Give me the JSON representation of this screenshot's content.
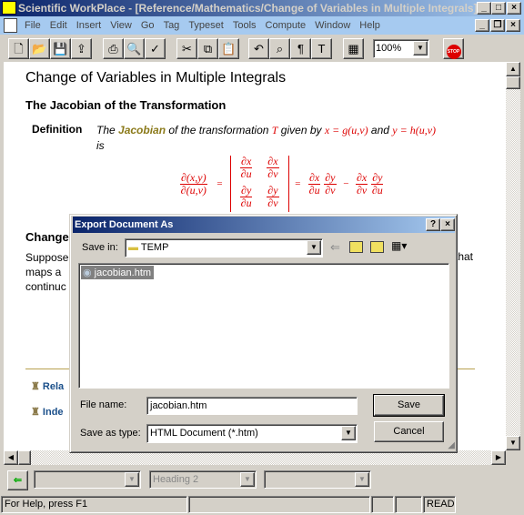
{
  "window": {
    "title": "Scientific WorkPlace - [Reference/Mathematics/Change of Variables in Multiple Integrals]",
    "min": "_",
    "max": "□",
    "close": "×",
    "doc_min": "_",
    "doc_restore": "❐",
    "doc_close": "×"
  },
  "menu": [
    "File",
    "Edit",
    "Insert",
    "View",
    "Go",
    "Tag",
    "Typeset",
    "Tools",
    "Compute",
    "Window",
    "Help"
  ],
  "toolbar": {
    "zoom": "100%",
    "stop": "STOP"
  },
  "document": {
    "heading": "Change of Variables in Multiple Integrals",
    "subheading": "The Jacobian of the Transformation",
    "definition_label": "Definition",
    "def_text_1": "The ",
    "def_jacobian": "Jacobian",
    "def_text_2": " of the transformation ",
    "def_T": "T",
    "def_text_3": " given by ",
    "def_x": "x = g(u,v)",
    "def_text_4": " and ",
    "def_y": "y = h(u,v)",
    "def_text_5": "is",
    "math": {
      "lhs_num": "∂(x,y)",
      "lhs_den": "∂(u,v)",
      "m11n": "∂x",
      "m11d": "∂u",
      "m12n": "∂x",
      "m12d": "∂v",
      "m21n": "∂y",
      "m21d": "∂u",
      "m22n": "∂y",
      "m22d": "∂v",
      "eq": "=",
      "minus": "−",
      "r1n": "∂x",
      "r1d": "∂u",
      "r2n": "∂y",
      "r2d": "∂v",
      "r3n": "∂x",
      "r3d": "∂v",
      "r4n": "∂y",
      "r4d": "∂u"
    },
    "section2": "Change",
    "p1": "Suppose",
    "p1_end": "that",
    "p2": "maps a",
    "p3": "continuc",
    "link1": "Rela",
    "link2": "Inde"
  },
  "dialog": {
    "title": "Export Document As",
    "help": "?",
    "close": "×",
    "save_in_label": "Save in:",
    "save_in_value": "TEMP",
    "files": [
      "jacobian.htm"
    ],
    "file_name_label": "File name:",
    "file_name_value": "jacobian.htm",
    "type_label": "Save as type:",
    "type_value": "HTML Document (*.htm)",
    "save": "Save",
    "cancel": "Cancel"
  },
  "bottom_toolbar": {
    "tag_value": "Heading 2"
  },
  "status": {
    "help": "For Help, press F1",
    "mode": "READ"
  },
  "colors": {
    "accent": "#0a246a",
    "math": "#dd0000",
    "jacobian": "#8b7a1a",
    "link": "#1a4f8a"
  }
}
